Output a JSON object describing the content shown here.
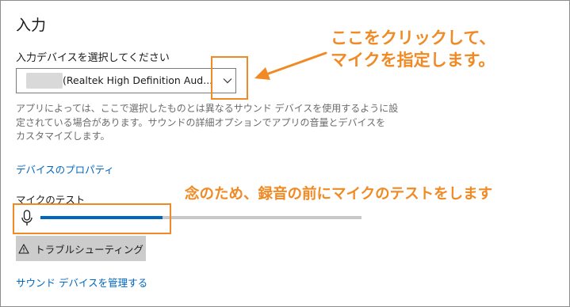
{
  "section": {
    "title": "入力"
  },
  "input_device": {
    "label": "入力デバイスを選択してください",
    "selected_value": "(Realtek High Definition Aud...",
    "dropdown_icon": "chevron-down-icon"
  },
  "description_lines": [
    "アプリによっては、ここで選択したものとは異なるサウンド デバイスを使用するように設",
    "定されている場合があります。サウンドの詳細オプションでアプリの音量とデバイスを",
    "カスタマイズします。"
  ],
  "device_properties_link": "デバイスのプロパティ",
  "mic_test": {
    "label": "マイクのテスト",
    "icon": "microphone-icon",
    "level_fraction": 0.38
  },
  "troubleshoot_button": {
    "icon": "warning-icon",
    "label": "トラブルシューティング"
  },
  "manage_link": "サウンド デバイスを管理する",
  "annotations": {
    "callout_dropdown": [
      "ここをクリックして、",
      "マイクを指定します。"
    ],
    "callout_mic": "念のため、録音の前にマイクのテストをします",
    "color": "#f08a24"
  },
  "colors": {
    "accent": "#0067c0",
    "meter_track": "#c8c8c8",
    "button_bg": "#cccccc",
    "description": "#6b6b6b"
  }
}
